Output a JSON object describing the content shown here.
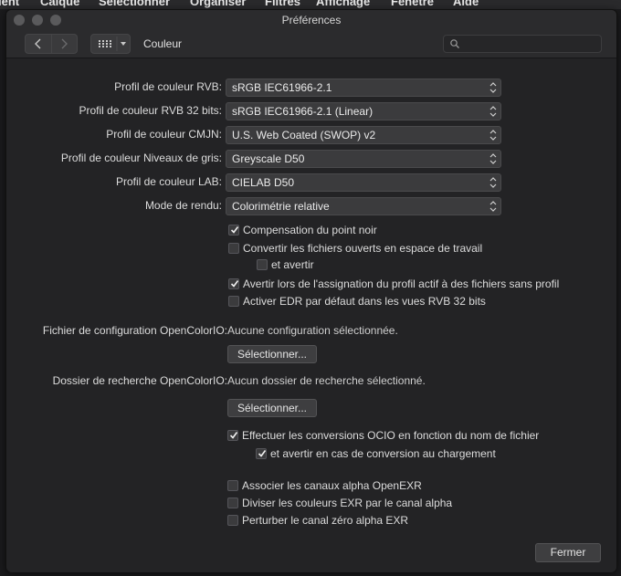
{
  "background_menu": [
    "ient",
    "Calque",
    "Sélectionner",
    "Organiser",
    "Filtres",
    "Affichage",
    "Fenêtre",
    "Aide"
  ],
  "window": {
    "title": "Préférences"
  },
  "toolbar": {
    "back_icon": "chevron-left-icon",
    "forward_icon": "chevron-right-icon",
    "grid_icon": "grid-icon",
    "section_title": "Couleur",
    "search_placeholder": ""
  },
  "profiles": [
    {
      "label": "Profil de couleur RVB:",
      "value": "sRGB IEC61966-2.1"
    },
    {
      "label": "Profil de couleur RVB 32 bits:",
      "value": "sRGB IEC61966-2.1 (Linear)"
    },
    {
      "label": "Profil de couleur CMJN:",
      "value": "U.S. Web Coated (SWOP) v2"
    },
    {
      "label": "Profil de couleur Niveaux de gris:",
      "value": "Greyscale D50"
    },
    {
      "label": "Profil de couleur LAB:",
      "value": "CIELAB D50"
    },
    {
      "label": "Mode de rendu:",
      "value": "Colorimétrie relative"
    }
  ],
  "checkboxes_top": [
    {
      "label": "Compensation du point noir",
      "checked": true
    },
    {
      "label": "Convertir les fichiers ouverts en espace de travail",
      "checked": false
    },
    {
      "label": "et avertir",
      "checked": false
    },
    {
      "label": "Avertir lors de l'assignation du profil actif à des fichiers sans profil",
      "checked": true
    },
    {
      "label": "Activer EDR par défaut dans les vues RVB 32 bits",
      "checked": false
    }
  ],
  "ocio": {
    "config_label": "Fichier de configuration OpenColorIO:",
    "config_value": "Aucune configuration sélectionnée.",
    "select_button": "Sélectionner...",
    "search_label": "Dossier de recherche OpenColorIO:",
    "search_value": "Aucun dossier de recherche sélectionné.",
    "select_button_2": "Sélectionner..."
  },
  "checkboxes_ocio": [
    {
      "label": "Effectuer les conversions OCIO en fonction du nom de fichier",
      "checked": true
    },
    {
      "label": "et avertir en cas de conversion au chargement",
      "checked": true
    }
  ],
  "checkboxes_exr": [
    {
      "label": "Associer les canaux alpha OpenEXR",
      "checked": false
    },
    {
      "label": "Diviser les couleurs EXR par le canal alpha",
      "checked": false
    },
    {
      "label": "Perturber le canal zéro alpha EXR",
      "checked": false
    }
  ],
  "footer": {
    "close_button": "Fermer"
  }
}
